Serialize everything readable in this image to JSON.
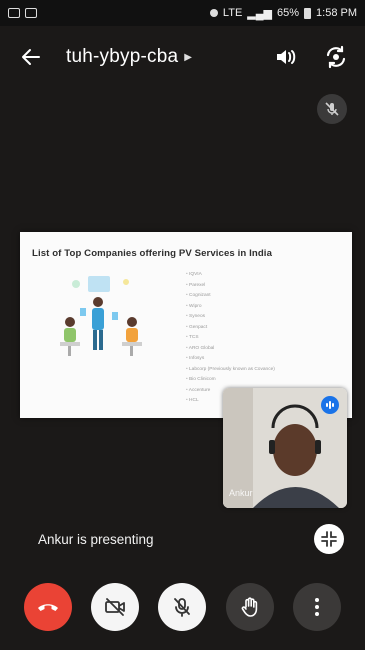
{
  "status": {
    "battery": "65%",
    "time": "1:58 PM",
    "network": "LTE"
  },
  "meeting": {
    "code": "tuh-ybyp-cba"
  },
  "slide": {
    "title": "List of Top Companies offering PV Services in India",
    "items": [
      "IQVIA",
      "Parexel",
      "Cognizant",
      "Wipro",
      "Syneos",
      "Genpact",
      "TCS",
      "ARO Global",
      "Infosys",
      "Labcorp (Previously known as Covance)",
      "Bio Clinicom",
      "Accenture",
      "HCL"
    ]
  },
  "participant": {
    "name": "Ankur"
  },
  "presenting_text": "Ankur is presenting",
  "colors": {
    "end_call": "#ea4335",
    "speaking": "#1a73e8"
  }
}
